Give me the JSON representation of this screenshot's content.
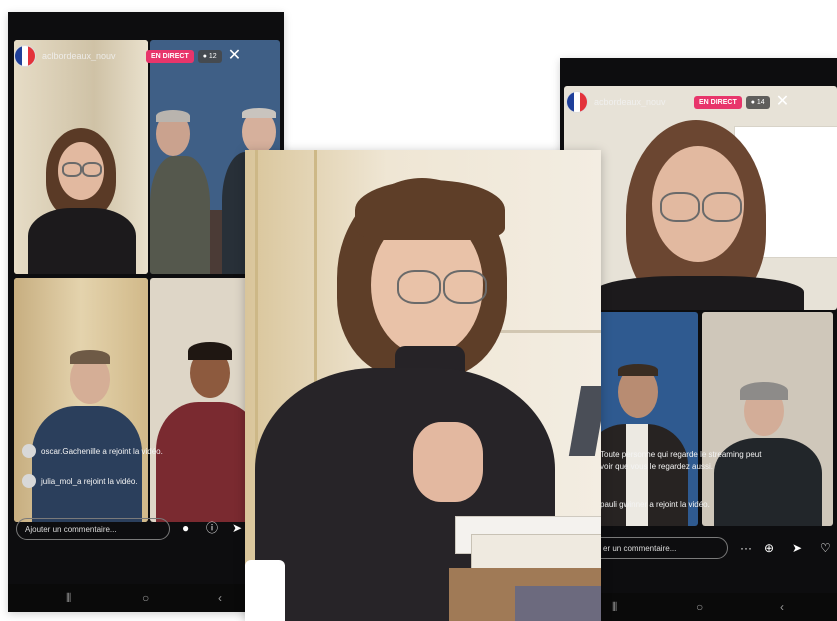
{
  "left_phone": {
    "username": "aclbordeaux_nouv",
    "live_badge": "EN DIRECT",
    "viewer_count": "● 12",
    "comments": [
      {
        "text": "oscar.Gachenille a rejoint la vidéo."
      },
      {
        "text": "julia_mol_a rejoint la vidéo."
      }
    ],
    "comment_placeholder": "Ajouter un commentaire..."
  },
  "right_phone": {
    "username": "acbordeaux_nouv",
    "live_badge": "EN DIRECT",
    "viewer_count": "● 14",
    "comments": [
      {
        "text": "Toute personne qui regarde le streaming peut"
      },
      {
        "text": "voir que vous le regardez aussi."
      },
      {
        "text": "pauli gwinner a rejoint la vidéo."
      }
    ],
    "comment_placeholder": "er un commentaire..."
  },
  "colors": {
    "live_badge": "#e8356b",
    "phone_frame": "#0d0d0f",
    "flag_blue": "#1f3f9a",
    "flag_red": "#e3323b"
  },
  "icons": [
    "close-icon",
    "share-icon",
    "help-icon",
    "send-icon",
    "heart-icon",
    "more-icon",
    "home-nav-icon",
    "back-nav-icon",
    "menu-nav-icon",
    "add-participant-icon"
  ]
}
